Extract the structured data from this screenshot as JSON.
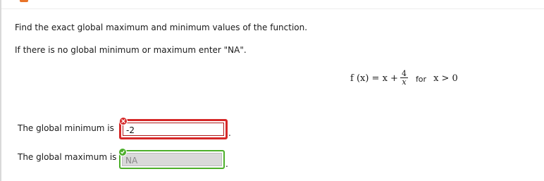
{
  "question": {
    "instruction": "Find the exact global maximum and minimum values of the function.",
    "na_instruction": "If there is no global minimum or maximum enter \"NA\"."
  },
  "formula": {
    "lhs": "f (x) = x +",
    "numerator": "4",
    "denominator": "x",
    "connector": "for",
    "condition": "x > 0"
  },
  "answers": {
    "minimum": {
      "label": "The global minimum is",
      "value": "-2",
      "status": "incorrect",
      "status_icon": "x-icon",
      "border_color": "#d62828"
    },
    "maximum": {
      "label": "The global maximum is",
      "value": "NA",
      "status": "correct",
      "status_icon": "check-icon",
      "border_color": "#4caf2a"
    }
  },
  "colors": {
    "incorrect": "#d62828",
    "correct": "#4caf2a",
    "accent": "#e8742a"
  }
}
